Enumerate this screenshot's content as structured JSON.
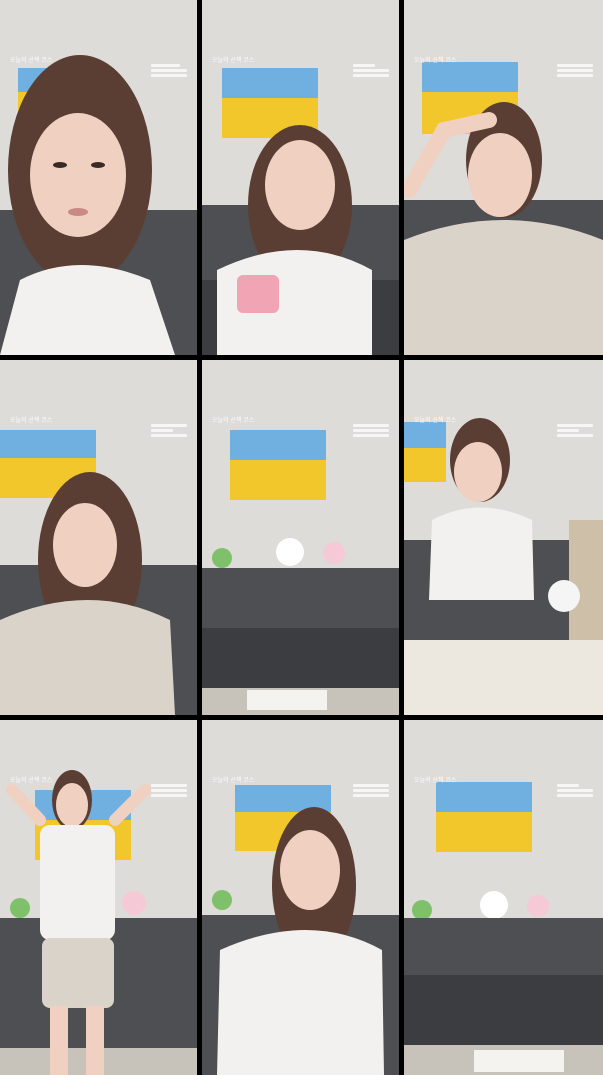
{
  "overlay": {
    "title": "오늘의 산책 코스"
  },
  "colors": {
    "wall": "#dedcd8",
    "sofa": "#4e4f52",
    "sofa_dark": "#3c3d40",
    "sunflower": "#f1c72b",
    "sky": "#6fb0e0",
    "grass": "#6bab57",
    "hair": "#5a3e33",
    "skin": "#f0d1c1",
    "shirt": "#f3f1ef",
    "pajama": "#d9d3c9"
  },
  "cells": [
    {
      "scene": "closeup-woman-white-tshirt"
    },
    {
      "scene": "woman-holding-pink-phone"
    },
    {
      "scene": "woman-pajamas-hand-on-head"
    },
    {
      "scene": "woman-pajamas-smiling"
    },
    {
      "scene": "empty-sofa-with-plushies"
    },
    {
      "scene": "woman-at-table-white-tshirt"
    },
    {
      "scene": "woman-standing-hands-on-head"
    },
    {
      "scene": "woman-white-tshirt-looking-down"
    },
    {
      "scene": "empty-sofa-room"
    }
  ]
}
